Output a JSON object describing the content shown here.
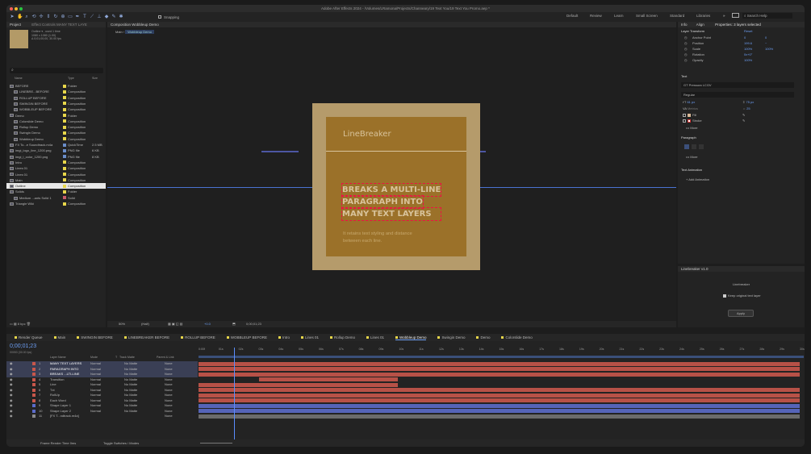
{
  "window": {
    "title": "Adobe After Effects 2024 - /Volumes/LRamona/Projects/Channeary/19 Text You/19 Text You Promo.aep *"
  },
  "workspaces": [
    "Default",
    "Review",
    "Learn",
    "Small Screen",
    "Standard",
    "Libraries"
  ],
  "search": {
    "placeholder": "Search Help"
  },
  "snapping": "Snapping",
  "project": {
    "tabs": [
      "Project",
      "Effect Controls MANY TEXT LAYE"
    ],
    "info": [
      "Outline ▾ , used 1 time",
      "1080 x 1080 (1.00)",
      "Δ 0;01;00;00, 30.00 fps"
    ],
    "search_placeholder": "",
    "cols": [
      "Name",
      "Type",
      "Size"
    ],
    "items": [
      {
        "name": "BEFORE",
        "type": "Folder",
        "size": "",
        "color": "#e7d64a",
        "icon": "folder",
        "indent": 0
      },
      {
        "name": "LINEBRE...BEFORE",
        "type": "Composition",
        "size": "",
        "color": "#e7d64a",
        "icon": "comp",
        "indent": 1
      },
      {
        "name": "ROLLUP BEFORE",
        "type": "Composition",
        "size": "",
        "color": "#e7d64a",
        "icon": "comp",
        "indent": 1
      },
      {
        "name": "SWINGIN BEFORE",
        "type": "Composition",
        "size": "",
        "color": "#e7d64a",
        "icon": "comp",
        "indent": 1
      },
      {
        "name": "WOBBLEUP BEFORE",
        "type": "Composition",
        "size": "",
        "color": "#e7d64a",
        "icon": "comp",
        "indent": 1
      },
      {
        "name": "Demo",
        "type": "Folder",
        "size": "",
        "color": "#e7d64a",
        "icon": "folder",
        "indent": 0
      },
      {
        "name": "Colorslide Demo",
        "type": "Composition",
        "size": "",
        "color": "#e7d64a",
        "icon": "comp",
        "indent": 1
      },
      {
        "name": "Rollup Demo",
        "type": "Composition",
        "size": "",
        "color": "#e7d64a",
        "icon": "comp",
        "indent": 1
      },
      {
        "name": "Swingin Demo",
        "type": "Composition",
        "size": "",
        "color": "#e7d64a",
        "icon": "comp",
        "indent": 1
      },
      {
        "name": "Wobbleup Demo",
        "type": "Composition",
        "size": "",
        "color": "#e7d64a",
        "icon": "comp",
        "indent": 1
      },
      {
        "name": "FX To...e Soundtrack.m4a",
        "type": "QuickTime",
        "size": "2.5 MB",
        "color": "#6a8dc9",
        "icon": "file",
        "indent": 0
      },
      {
        "name": "imgi_logo_line_1200.png",
        "type": "PNG file",
        "size": "6 KB",
        "color": "#6a8dc9",
        "icon": "file",
        "indent": 0
      },
      {
        "name": "imgi_l_color_1200.png",
        "type": "PNG file",
        "size": "8 KB",
        "color": "#6a8dc9",
        "icon": "file",
        "indent": 0
      },
      {
        "name": "Intro",
        "type": "Composition",
        "size": "",
        "color": "#e7d64a",
        "icon": "comp",
        "indent": 0
      },
      {
        "name": "Lines 01",
        "type": "Composition",
        "size": "",
        "color": "#e7d64a",
        "icon": "comp",
        "indent": 0
      },
      {
        "name": "Lines 01",
        "type": "Composition",
        "size": "",
        "color": "#e7d64a",
        "icon": "comp",
        "indent": 0
      },
      {
        "name": "Main",
        "type": "Composition",
        "size": "",
        "color": "#e7d64a",
        "icon": "comp",
        "indent": 0
      },
      {
        "name": "Outline",
        "type": "Composition",
        "size": "",
        "color": "#e7d64a",
        "icon": "comp",
        "indent": 0,
        "selected": true
      },
      {
        "name": "Solids",
        "type": "Folder",
        "size": "",
        "color": "#e7d64a",
        "icon": "folder",
        "indent": 0
      },
      {
        "name": "Medium ...ants Solid 1",
        "type": "Solid",
        "size": "",
        "color": "#c95a6b",
        "icon": "solid",
        "indent": 1
      },
      {
        "name": "Triangle Wiki",
        "type": "Composition",
        "size": "",
        "color": "#e7d64a",
        "icon": "comp",
        "indent": 0
      }
    ],
    "bpc": "8 bpc"
  },
  "comp": {
    "tab": "Composition Wobbleup Demo",
    "breadcrumbs": [
      "Main",
      "Wobbleup Demo"
    ],
    "title": "LineBreaker",
    "big_lines": [
      "BREAKS A MULTI-LINE",
      "PARAGRAPH INTO",
      "MANY TEXT LAYERS"
    ],
    "small_text": [
      "It retains text styling and distance",
      "between each line."
    ],
    "zoom": "50%",
    "res": "(Half)",
    "fps_label": "+0.0",
    "timecode": "0;00;01;23"
  },
  "props": {
    "tabs": [
      "Info",
      "Align",
      "Properties: 3 layers selected"
    ],
    "layer_transform": "Layer Transform",
    "reset": "Reset",
    "rows": [
      {
        "label": "Anchor Point",
        "v1": "0",
        "v2": "0"
      },
      {
        "label": "Position",
        "v1": "199.6",
        "v2": "~"
      },
      {
        "label": "Scale",
        "v1": "100%",
        "v2": "100%"
      },
      {
        "label": "Rotation",
        "v1": "0x+0°",
        "v2": ""
      },
      {
        "label": "Opacity",
        "v1": "100%",
        "v2": ""
      }
    ],
    "text_label": "Text",
    "font": "GT Pressura LCGV",
    "style": "Regular",
    "font_size": "61 px",
    "leading": "75 px",
    "tracking_label": "Metrics",
    "kerning": "25",
    "fill": "Fill",
    "stroke": "Stroke",
    "more": "More",
    "paragraph": "Paragraph",
    "more2": "More",
    "text_animation": "Text Animation",
    "add_animation": "Add Animation"
  },
  "linebreaker": {
    "tab": "Linebreaker v1.0",
    "title": "Linebreaker",
    "checkbox": "Keep original text layer",
    "apply": "Apply"
  },
  "timeline": {
    "tabs": [
      "Render Queue",
      "Main",
      "SWINGIN BEFORE",
      "LINEBREAKER BEFORE",
      "ROLLUP BEFORE",
      "WOBBLEUP BEFORE",
      "Intro",
      "Lines 01",
      "Rollup Demo",
      "Lines 01",
      "Wobbleup Demo",
      "Swingin Demo",
      "Demo",
      "Colorslide Demo"
    ],
    "timecode": "0;00;01;23",
    "frames": "00053 (30.00 fps)",
    "cols": [
      "Layer Name",
      "Mode",
      "T",
      "Track Matte",
      "Parent & Link"
    ],
    "ruler": [
      "0:00f",
      "01s",
      "02s",
      "03s",
      "04s",
      "05s",
      "06s",
      "07s",
      "08s",
      "09s",
      "10s",
      "11s",
      "12s",
      "13s",
      "14s",
      "15s",
      "16s",
      "17s",
      "18s",
      "19s",
      "20s",
      "21s",
      "22s",
      "23s",
      "24s",
      "25s",
      "26s",
      "27s",
      "28s",
      "29s",
      "30s"
    ],
    "layers": [
      {
        "n": "1",
        "name": "MANY TEXT LAYERS",
        "mode": "Normal",
        "matte": "No Matte",
        "parent": "None",
        "color": "#c8574b",
        "sel": true
      },
      {
        "n": "2",
        "name": "PARAGRAPH INTO",
        "mode": "Normal",
        "matte": "No Matte",
        "parent": "None",
        "color": "#c8574b",
        "sel": true
      },
      {
        "n": "3",
        "name": "BREAKS ...LTI-LINE",
        "mode": "Normal",
        "matte": "No Matte",
        "parent": "None",
        "color": "#c8574b",
        "sel": true
      },
      {
        "n": "4",
        "name": "Transition",
        "mode": "Normal",
        "matte": "No Matte",
        "parent": "None",
        "color": "#c8574b",
        "sel": false
      },
      {
        "n": "5",
        "name": "Line",
        "mode": "Normal",
        "matte": "No Matte",
        "parent": "None",
        "color": "#c8574b",
        "sel": false
      },
      {
        "n": "6",
        "name": "Txt",
        "mode": "Normal",
        "matte": "No Matte",
        "parent": "None",
        "color": "#c8574b",
        "sel": false
      },
      {
        "n": "7",
        "name": "RollUp",
        "mode": "Normal",
        "matte": "No Matte",
        "parent": "None",
        "color": "#c8574b",
        "sel": false
      },
      {
        "n": "8",
        "name": "Each Word",
        "mode": "Normal",
        "matte": "No Matte",
        "parent": "None",
        "color": "#c8574b",
        "sel": false
      },
      {
        "n": "9",
        "name": "Shape Layer 1",
        "mode": "Normal",
        "matte": "No Matte",
        "parent": "None",
        "color": "#5b6bc9",
        "sel": false
      },
      {
        "n": "10",
        "name": "Shape Layer 2",
        "mode": "Normal",
        "matte": "No Matte",
        "parent": "None",
        "color": "#5b6bc9",
        "sel": false
      },
      {
        "n": "11",
        "name": "[FX T...ndtrack.m4a]",
        "mode": "",
        "matte": "",
        "parent": "None",
        "color": "#8a8a8a",
        "sel": false
      }
    ],
    "footer": {
      "render_time": "Frame Render Time",
      "render_val": "0ms",
      "toggle": "Toggle Switches / Modes"
    }
  }
}
